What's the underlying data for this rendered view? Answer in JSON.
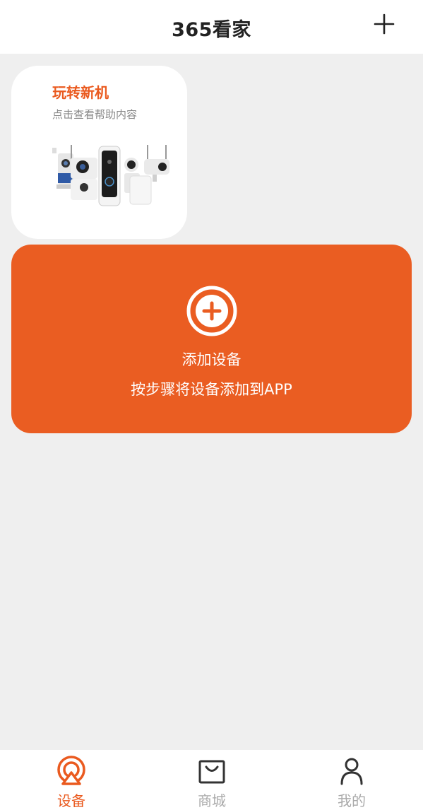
{
  "header": {
    "title": "365看家",
    "add_icon": "plus-icon"
  },
  "guide_card": {
    "title": "玩转新机",
    "subtitle": "点击查看帮助内容",
    "image": "security-cameras-product-image"
  },
  "add_device": {
    "icon": "plus-circle-icon",
    "title": "添加设备",
    "subtitle": "按步骤将设备添加到APP"
  },
  "tabbar": {
    "items": [
      {
        "label": "设备",
        "icon": "device-icon",
        "active": true
      },
      {
        "label": "商城",
        "icon": "shopping-bag-icon",
        "active": false
      },
      {
        "label": "我的",
        "icon": "person-icon",
        "active": false
      }
    ]
  },
  "colors": {
    "accent": "#ea5d22",
    "background": "#efefef",
    "inactive_tab": "#aaaaaa"
  }
}
